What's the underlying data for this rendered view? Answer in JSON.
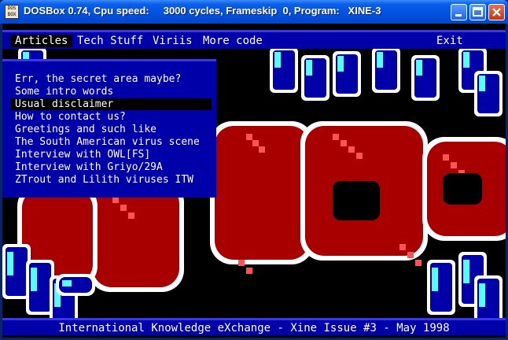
{
  "window": {
    "title": "DOSBox 0.74, Cpu speed:     3000 cycles, Frameskip  0, Program:   XINE-3",
    "icon_text": "DOS BOX",
    "buttons": [
      "minimize-icon",
      "maximize-icon",
      "close-icon"
    ]
  },
  "menu": {
    "items": [
      "Articles",
      "Tech Stuff",
      "Viriis",
      "More code"
    ],
    "exit": "Exit",
    "active_index": 0
  },
  "dropdown": {
    "items": [
      "Err, the secret area maybe?",
      "Some intro words",
      "Usual disclaimer",
      "How to contact us?",
      "Greetings and such like",
      "The South American virus scene",
      "Interview with OWL[FS]",
      "Interview with Griyo/29A",
      "ZTrout and Lilith viruses ITW"
    ],
    "selected_index": 2
  },
  "status": {
    "text": "International Knowledge eXchange - Xine Issue #3 - May 1998"
  },
  "colors": {
    "dos_blue": "#0000a8",
    "highlight": "#3838e8",
    "logo_red": "#a80000",
    "logo_pink": "#fc5454",
    "cyan": "#54fcfc"
  }
}
